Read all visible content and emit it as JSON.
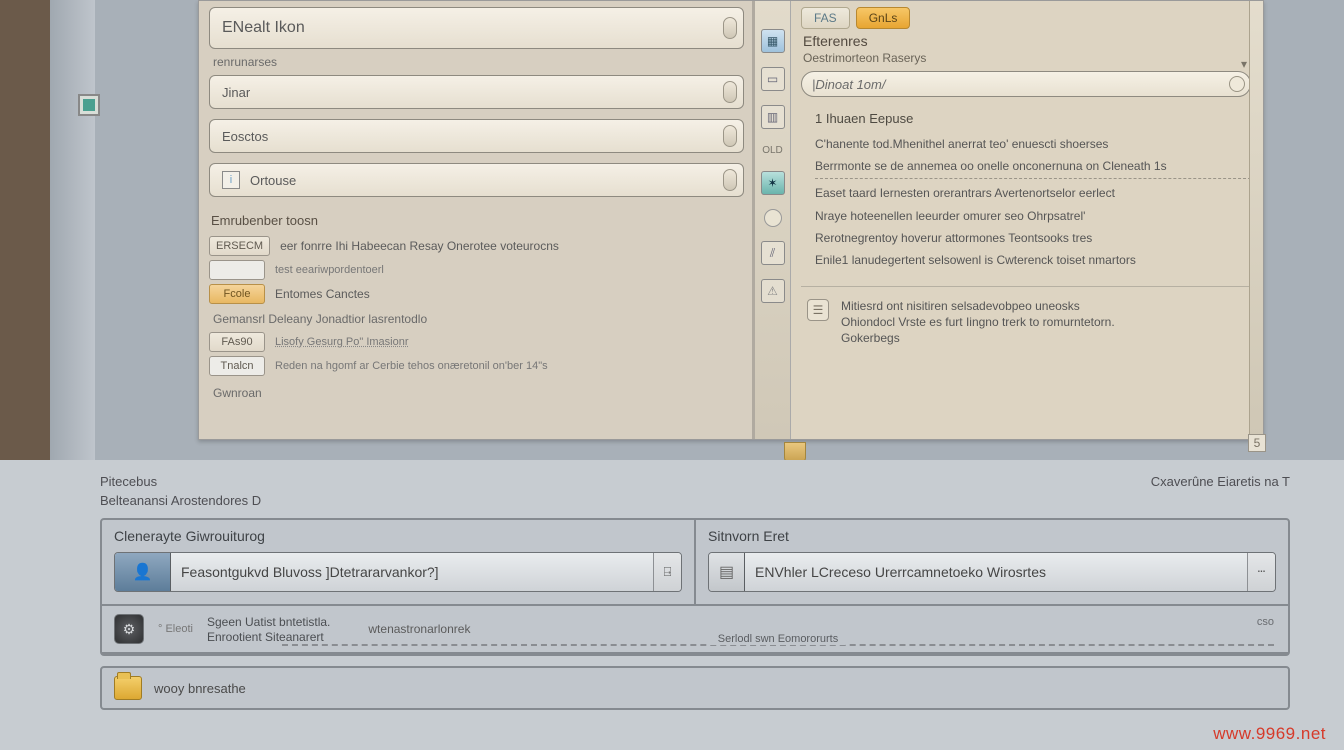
{
  "left_pane": {
    "main_field": "ENealt Ikon",
    "sub_label": "renrunarses",
    "field2": "Jinar",
    "field3": "Eosctos",
    "field4": "Ortouse",
    "section_header": "Emrubenber toosn",
    "rows": [
      {
        "chip": "ERSECM",
        "text": "eer fonrre Ihi Habeecan Resay Onerotee voteurocns"
      },
      {
        "chip": "",
        "text": "test eeariwpordentoerl"
      },
      {
        "chip": "Fcole",
        "chip_class": "orange",
        "text": "Entomes  Canctes"
      }
    ],
    "sub_section": "Gemansrl Deleany Jonadtior lasrentodlo",
    "btn1": "FAs90",
    "btn2": "Tnalcn",
    "line1": "Lisofy Gesurg Po\" Imasionr",
    "line2": "Reden na hgomf ar Cerbie tehos onæretonil on'ber 14\"s",
    "footer": "Gwnroan"
  },
  "right_pane": {
    "tab1": "FAS",
    "tab2": "GnLs",
    "title": "Efterenres",
    "subtitle": "Oestrimorteon Raserys",
    "search_placeholder": "|Dinoat 1om/",
    "body_title": "1 Ihuaen Eepuse",
    "p1": "C'hanente tod.Mhenithel anerrat teo' enuescti shoerses",
    "p2": "Berrmonte se de annemea oo onelle onconernuna on Cleneath 1s",
    "p3": "Easet taard Iernesten orerantrars Avertenortselor eerlect",
    "p4": "Nraye hoteenellen leeurder omurer seo Ohrpsatrel'",
    "p5": "Rerotnegrentoy hoverur attormones Teontsooks tres",
    "p6": "Enile1 lanudegertent selsowenl is Cwterenck toiset nmartors",
    "note1": "Mitiesrd ont nisitiren selsadevobpeo uneosks",
    "note2": "Ohiondocl Vrste es furt Iingno trerk  to romurntetorn.",
    "note3": "Gokerbegs"
  },
  "lower": {
    "meta_left": "Pitecebus",
    "meta_right": "Cxaverûne Eiaretis na T",
    "meta2": "Belteanansi Arostendores  D",
    "col1_title": "Clenerayte Giwrouiturog",
    "col1_value": "Feasontgukvd Bluvoss ]Dtetrararvankor?]",
    "col2_title": "Sitnvorn Eret",
    "col2_value": "ENVhler  LCreceso Urerrcamnetoeko Wirosrtes",
    "row2_small": "° Eleoti",
    "row2_a": "Sgeen Uatist bntetistla.",
    "row2_b": "Enrootient   Siteanarert",
    "row2_c": "wtenastronarlonrek",
    "row2_num": "cso",
    "dash_label": "Serlodl swn Eomororurts",
    "card2_text": "wooy bnresathe"
  },
  "corner_sq": "5",
  "watermark": "www.9969.net"
}
